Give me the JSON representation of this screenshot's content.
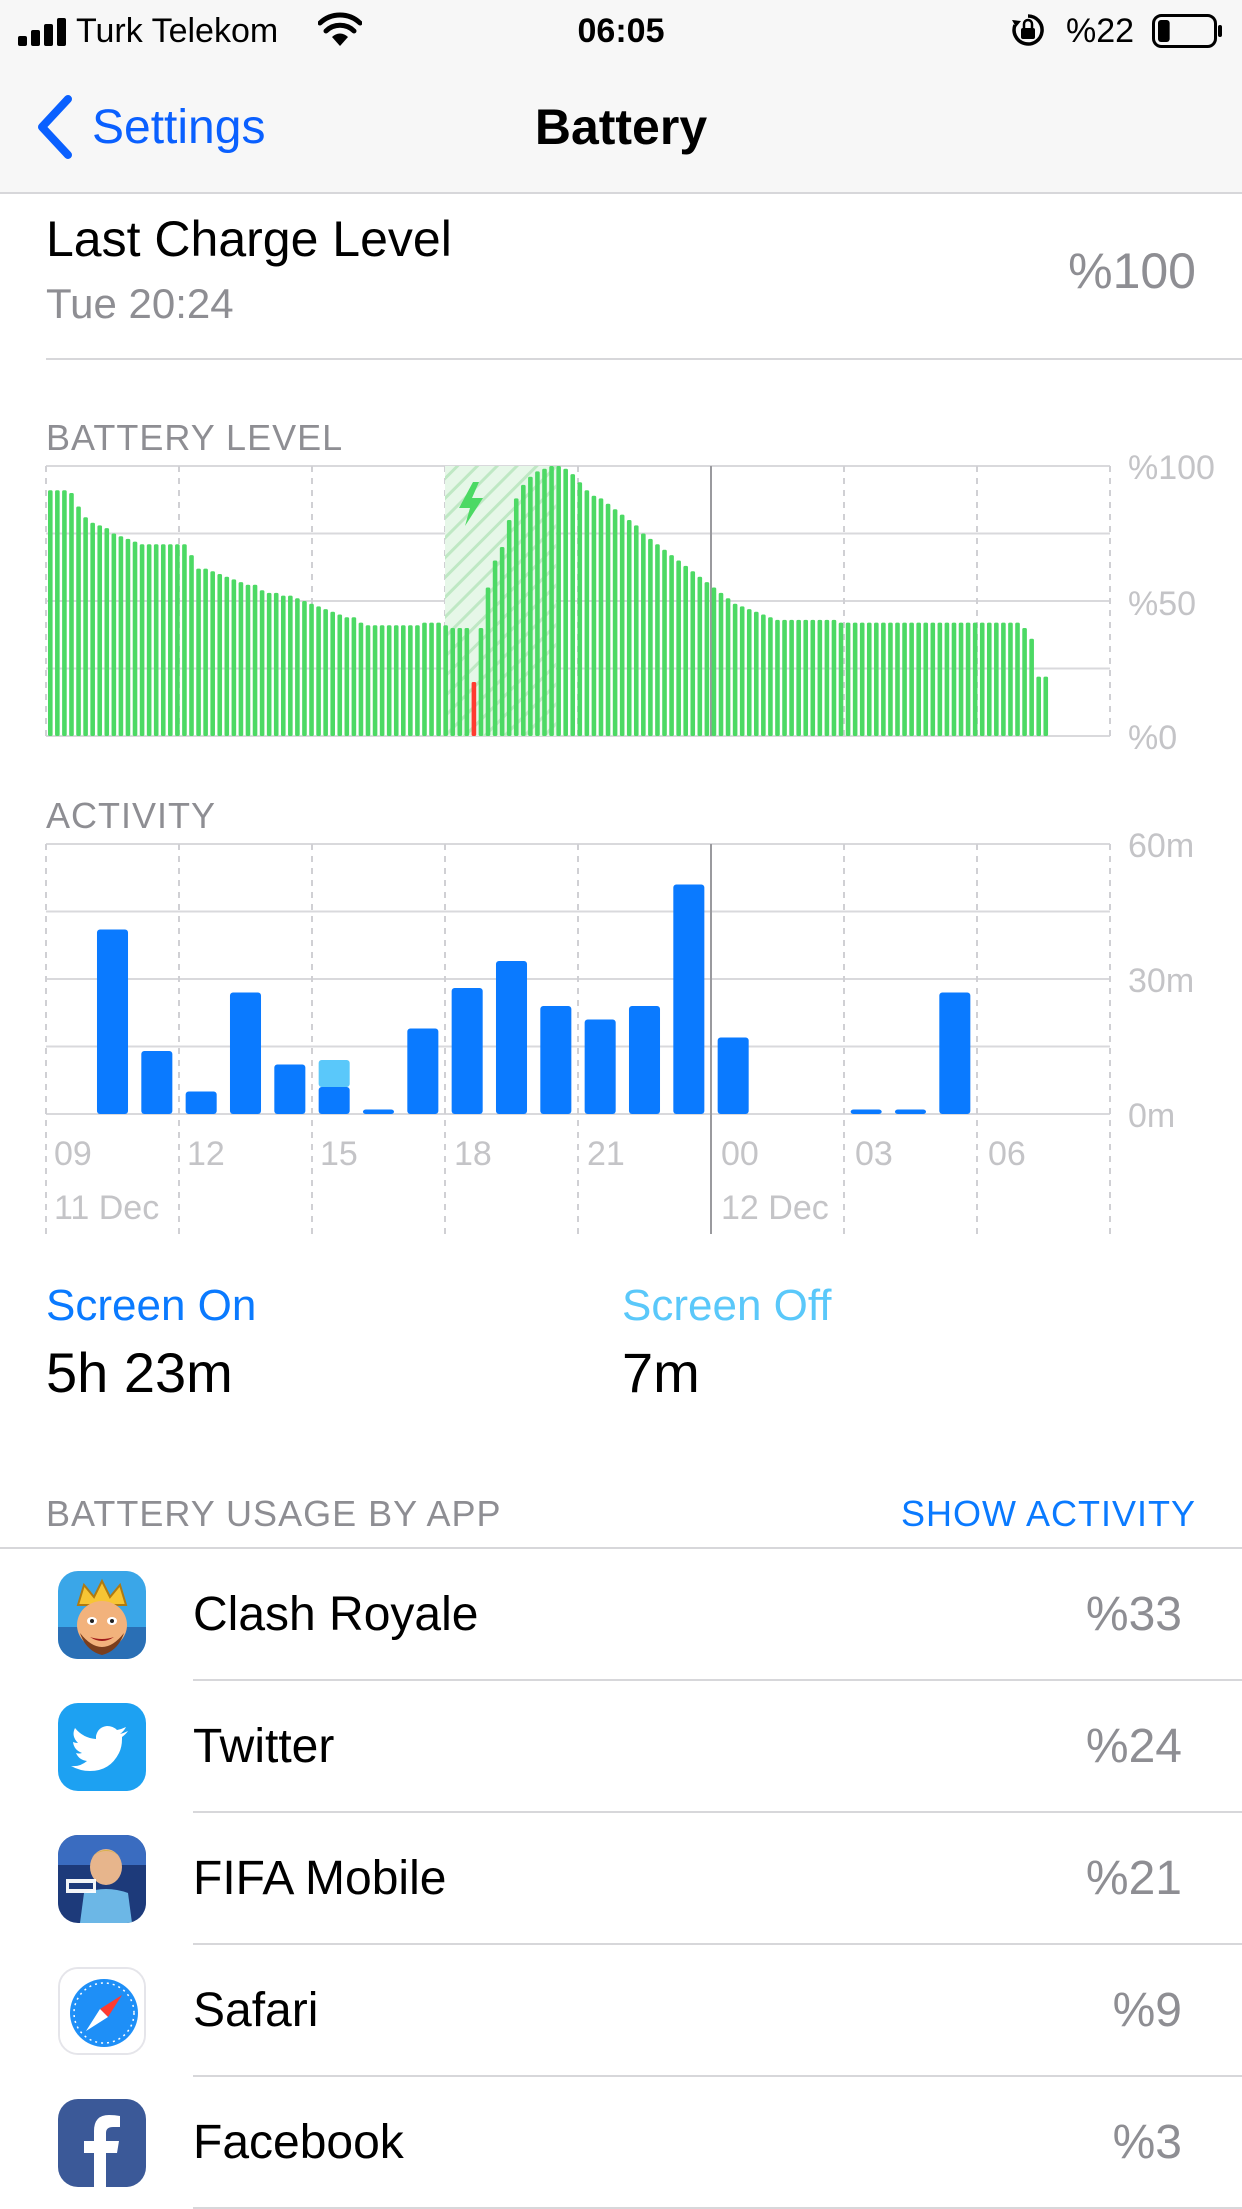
{
  "status_bar": {
    "carrier": "Turk Telekom",
    "time": "06:05",
    "battery_percent": "%22",
    "battery_level": 0.22,
    "icons": [
      "signal-icon",
      "wifi-icon",
      "rotation-lock-icon",
      "battery-icon"
    ]
  },
  "nav": {
    "back_label": "Settings",
    "title": "Battery"
  },
  "last_charge": {
    "title": "Last Charge Level",
    "time": "Tue 20:24",
    "value": "%100"
  },
  "battery_level_section": {
    "label": "BATTERY LEVEL",
    "y_labels": [
      "%100",
      "%50",
      "%0"
    ]
  },
  "activity_section": {
    "label": "ACTIVITY",
    "y_labels": [
      "60m",
      "30m",
      "0m"
    ],
    "x_labels": [
      "09",
      "12",
      "15",
      "18",
      "21",
      "00",
      "03",
      "06"
    ],
    "date_labels": [
      "11 Dec",
      "12 Dec"
    ]
  },
  "chart_data": [
    {
      "type": "bar",
      "title": "BATTERY LEVEL",
      "ylim": [
        0,
        100
      ],
      "y_ticks": [
        "%0",
        "%50",
        "%100"
      ],
      "x_range_hours": [
        9,
        33
      ],
      "charging_interval_hours": [
        18.0,
        20.5
      ],
      "low_power_marker_hour": 18.0,
      "values": [
        91,
        91,
        91,
        90,
        85,
        81,
        79,
        78,
        77,
        75,
        74,
        73,
        72,
        71,
        71,
        71,
        71,
        71,
        71,
        71,
        67,
        62,
        62,
        61,
        60,
        59,
        58,
        57,
        56,
        56,
        54,
        53,
        53,
        52,
        52,
        51,
        50,
        49,
        48,
        47,
        46,
        45,
        44,
        44,
        42,
        41,
        41,
        41,
        41,
        41,
        41,
        41,
        41,
        42,
        42,
        42,
        41,
        40,
        40,
        40,
        20,
        40,
        55,
        65,
        70,
        80,
        88,
        93,
        96,
        98,
        99,
        100,
        100,
        99,
        97,
        94,
        91,
        89,
        88,
        86,
        84,
        82,
        80,
        78,
        75,
        73,
        71,
        69,
        67,
        65,
        63,
        61,
        59,
        57,
        55,
        53,
        51,
        49,
        48,
        47,
        46,
        45,
        44,
        43,
        43,
        43,
        43,
        43,
        43,
        43,
        43,
        43,
        42,
        42,
        42,
        42,
        42,
        42,
        42,
        42,
        42,
        42,
        42,
        42,
        42,
        42,
        42,
        42,
        42,
        42,
        42,
        42,
        42,
        42,
        42,
        42,
        42,
        42,
        40,
        36,
        22,
        22
      ]
    },
    {
      "type": "bar",
      "title": "ACTIVITY",
      "ylim": [
        0,
        60
      ],
      "y_unit": "minutes",
      "x_range_hours": [
        9,
        33
      ],
      "series": [
        {
          "name": "Screen On",
          "color": "#0a7aff",
          "hours": [
            10,
            11,
            12,
            13,
            14,
            15,
            16,
            17,
            18,
            19,
            20,
            21,
            22,
            23,
            24,
            27,
            28,
            29
          ],
          "values": [
            41,
            14,
            5,
            27,
            11,
            6,
            1,
            19,
            28,
            34,
            24,
            21,
            24,
            51,
            17,
            1,
            1,
            27
          ]
        },
        {
          "name": "Screen Off",
          "color": "#5ac8fa",
          "hours": [
            15
          ],
          "values": [
            6
          ]
        }
      ]
    }
  ],
  "screen_stats": {
    "on_label": "Screen On",
    "on_value": "5h 23m",
    "off_label": "Screen Off",
    "off_value": "7m"
  },
  "usage": {
    "header": "BATTERY USAGE BY APP",
    "show_activity": "SHOW ACTIVITY",
    "apps": [
      {
        "name": "Clash Royale",
        "percent": "%33",
        "icon": "clash-royale-icon"
      },
      {
        "name": "Twitter",
        "percent": "%24",
        "icon": "twitter-icon"
      },
      {
        "name": "FIFA Mobile",
        "percent": "%21",
        "icon": "fifa-mobile-icon"
      },
      {
        "name": "Safari",
        "percent": "%9",
        "icon": "safari-icon"
      },
      {
        "name": "Facebook",
        "percent": "%3",
        "icon": "facebook-icon"
      }
    ]
  },
  "colors": {
    "accent": "#0a60ff",
    "battery_green": "#4cd964",
    "battery_red": "#ff3b30",
    "screen_on": "#0a7aff",
    "screen_off": "#5ac8fa",
    "secondary_text": "#8e8e93"
  }
}
